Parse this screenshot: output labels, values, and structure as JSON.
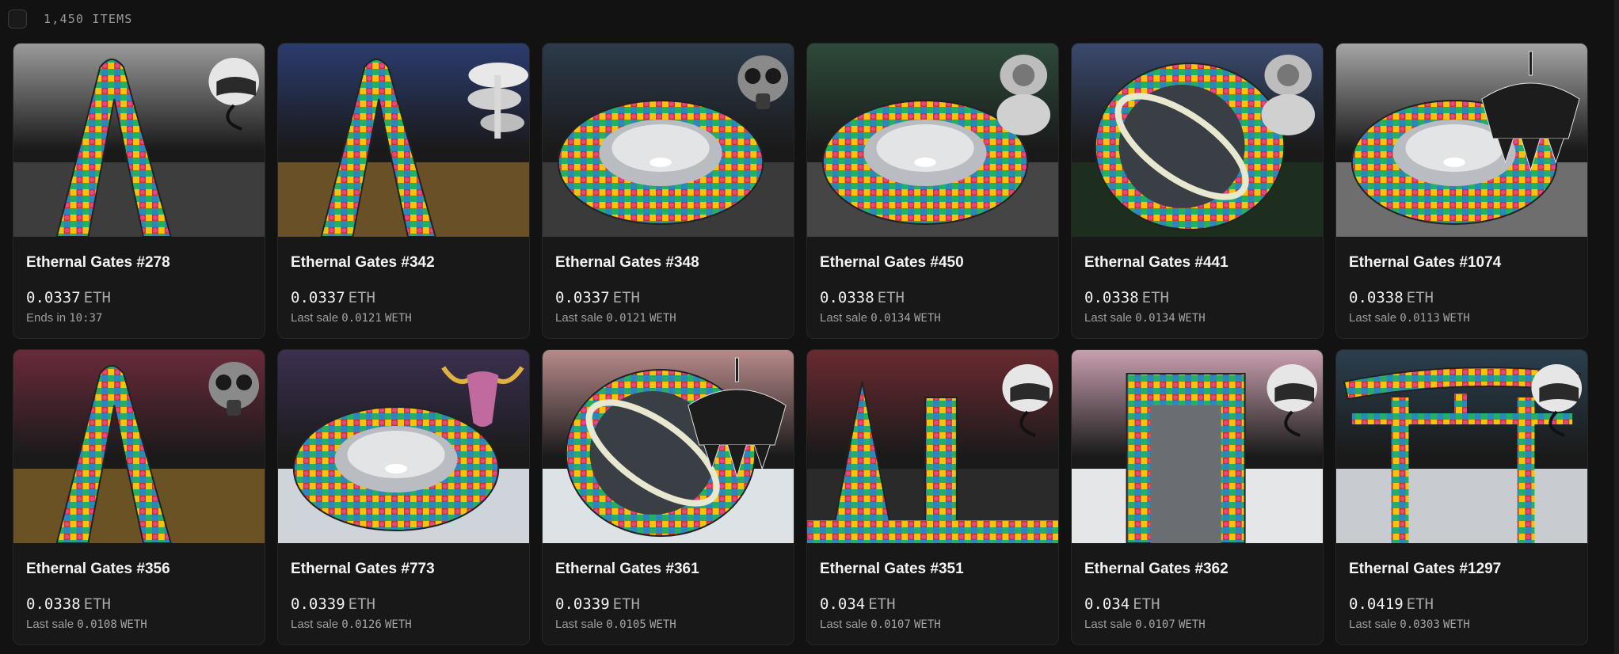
{
  "header": {
    "item_count": "1,450 ITEMS"
  },
  "theme": {
    "background": "#121212",
    "card": "#181818",
    "border": "#262626"
  },
  "items": [
    {
      "title": "Ethernal Gates #278",
      "price": "0.0337",
      "currency": "ETH",
      "sub_label": "Ends in",
      "sub_value": "10:37",
      "sub_mono": "",
      "sky": "#9a9a9a",
      "ground": "#3d3d3d",
      "gate": "arch",
      "object": "helmet-icon"
    },
    {
      "title": "Ethernal Gates #342",
      "price": "0.0337",
      "currency": "ETH",
      "sub_label": "Last sale",
      "sub_value": "0.0121",
      "sub_mono": "WETH",
      "sky": "#2b3b6e",
      "ground": "#6a5026",
      "gate": "arch",
      "object": "mushroom-icon"
    },
    {
      "title": "Ethernal Gates #348",
      "price": "0.0337",
      "currency": "ETH",
      "sub_label": "Last sale",
      "sub_value": "0.0121",
      "sub_mono": "WETH",
      "sky": "#2c3a4a",
      "ground": "#3a3a3a",
      "gate": "ring",
      "object": "gas-mask-icon"
    },
    {
      "title": "Ethernal Gates #450",
      "price": "0.0338",
      "currency": "ETH",
      "sub_label": "Last sale",
      "sub_value": "0.0134",
      "sub_mono": "WETH",
      "sky": "#2d4a3a",
      "ground": "#454545",
      "gate": "ring",
      "object": "astronaut-icon"
    },
    {
      "title": "Ethernal Gates #441",
      "price": "0.0338",
      "currency": "ETH",
      "sub_label": "Last sale",
      "sub_value": "0.0134",
      "sub_mono": "WETH",
      "sky": "#3a4a6e",
      "ground": "#1e2e1e",
      "gate": "torus",
      "object": "astronaut-icon"
    },
    {
      "title": "Ethernal Gates #1074",
      "price": "0.0338",
      "currency": "ETH",
      "sub_label": "Last sale",
      "sub_value": "0.0113",
      "sub_mono": "WETH",
      "sky": "#a5a5a5",
      "ground": "#6e6e6e",
      "gate": "ring",
      "object": "chandelier-icon"
    },
    {
      "title": "Ethernal Gates #356",
      "price": "0.0338",
      "currency": "ETH",
      "sub_label": "Last sale",
      "sub_value": "0.0108",
      "sub_mono": "WETH",
      "sky": "#6a2a3a",
      "ground": "#6b5224",
      "gate": "arch",
      "object": "gas-mask-icon"
    },
    {
      "title": "Ethernal Gates #773",
      "price": "0.0339",
      "currency": "ETH",
      "sub_label": "Last sale",
      "sub_value": "0.0126",
      "sub_mono": "WETH",
      "sky": "#3b3050",
      "ground": "#cfd4da",
      "gate": "ring",
      "object": "skull-icon"
    },
    {
      "title": "Ethernal Gates #361",
      "price": "0.0339",
      "currency": "ETH",
      "sub_label": "Last sale",
      "sub_value": "0.0105",
      "sub_mono": "WETH",
      "sky": "#b88a8a",
      "ground": "#dde2e6",
      "gate": "torus",
      "object": "chandelier-icon"
    },
    {
      "title": "Ethernal Gates #351",
      "price": "0.034",
      "currency": "ETH",
      "sub_label": "Last sale",
      "sub_value": "0.0107",
      "sub_mono": "WETH",
      "sky": "#6a2a30",
      "ground": "#2a2a2a",
      "gate": "pillars",
      "object": "helmet-icon"
    },
    {
      "title": "Ethernal Gates #362",
      "price": "0.034",
      "currency": "ETH",
      "sub_label": "Last sale",
      "sub_value": "0.0107",
      "sub_mono": "WETH",
      "sky": "#c9a0b0",
      "ground": "#e4e6e8",
      "gate": "door",
      "object": "helmet-icon"
    },
    {
      "title": "Ethernal Gates #1297",
      "price": "0.0419",
      "currency": "ETH",
      "sub_label": "Last sale",
      "sub_value": "0.0303",
      "sub_mono": "WETH",
      "sky": "#2a3f4e",
      "ground": "#c8ccd0",
      "gate": "torii",
      "object": "helmet-icon"
    }
  ]
}
